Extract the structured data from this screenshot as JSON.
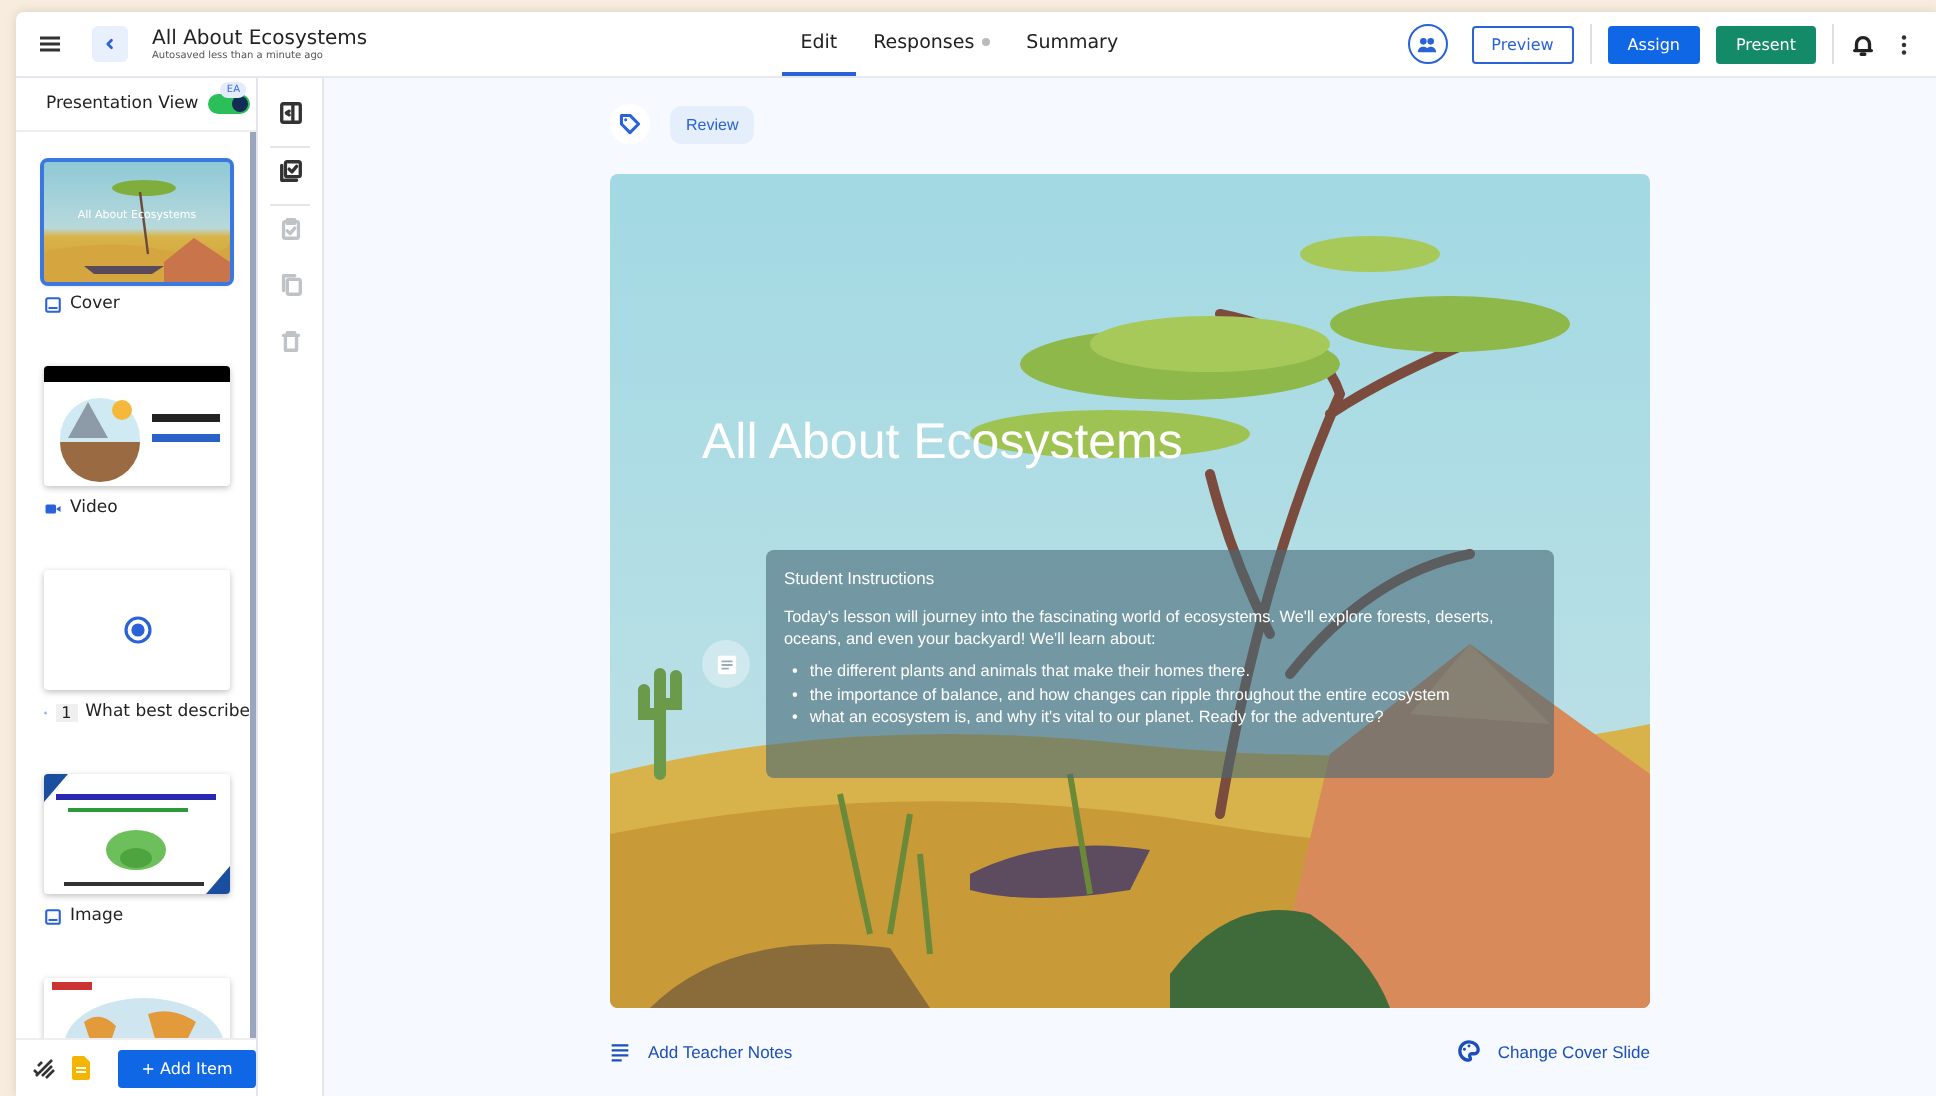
{
  "header": {
    "title": "All About Ecosystems",
    "subtitle": "Autosaved less than a minute ago",
    "tabs": [
      {
        "label": "Edit",
        "selected": true,
        "dot": false
      },
      {
        "label": "Responses",
        "selected": false,
        "dot": true
      },
      {
        "label": "Summary",
        "selected": false,
        "dot": false
      }
    ],
    "buttons": [
      {
        "label": "Preview",
        "kind": "outline"
      },
      {
        "label": "Assign",
        "kind": "primary"
      },
      {
        "label": "Present",
        "kind": "success"
      }
    ]
  },
  "sidebar": {
    "presentation_view": {
      "label": "Presentation View",
      "on": true,
      "badge": "EA"
    },
    "slides": [
      {
        "kind": "cover",
        "label": "Cover",
        "selected": true,
        "thumb_title": "All About Ecosystems"
      },
      {
        "kind": "video",
        "label": "Video",
        "selected": false
      },
      {
        "kind": "question",
        "label": "What best describe",
        "number": "1",
        "selected": false
      },
      {
        "kind": "image",
        "label": "Image",
        "selected": false
      },
      {
        "kind": "map",
        "selected": false
      }
    ],
    "add_button": "+ Add Item"
  },
  "tools": [
    {
      "kind": "panel",
      "disabled": false
    },
    {
      "kind": "checklist",
      "disabled": false
    },
    {
      "kind": "clipboard",
      "disabled": true
    },
    {
      "kind": "copy",
      "disabled": true
    },
    {
      "kind": "trash",
      "disabled": true
    }
  ],
  "editor": {
    "tag": "Review",
    "cover": {
      "title": "All About Ecosystems",
      "instructions_heading": "Student Instructions",
      "instructions": "Today's lesson will journey into the fascinating world of ecosystems. We'll explore forests, deserts, oceans, and even your backyard! We'll learn about:",
      "marker": "•",
      "bullets": [
        "the different plants and animals that make their homes there.",
        "the importance of balance, and how changes can ripple throughout the entire ecosystem",
        "what an ecosystem is, and why it's vital to our planet. Ready for the adventure?"
      ]
    },
    "notes_link": "Add Teacher Notes",
    "change_cover_link": "Change Cover Slide"
  }
}
